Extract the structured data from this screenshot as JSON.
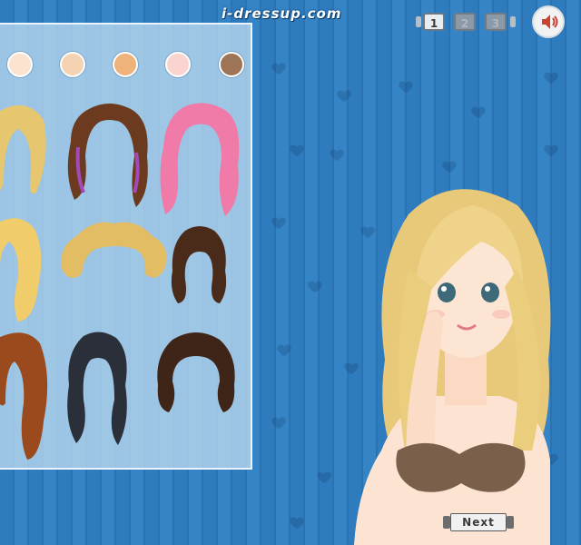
{
  "header": {
    "site_logo": "i-dressup.com"
  },
  "skin_tones": [
    {
      "name": "pale",
      "color": "#fbe3cf"
    },
    {
      "name": "light",
      "color": "#f4d2b2"
    },
    {
      "name": "tan",
      "color": "#efb27a"
    },
    {
      "name": "pink",
      "color": "#fcd4cf"
    },
    {
      "name": "brown",
      "color": "#9d7456"
    }
  ],
  "hair_styles": [
    {
      "name": "blonde-long-wavy",
      "color": "#e6c66e"
    },
    {
      "name": "brown-pigtails-purple-streak",
      "color": "#6b3a1f"
    },
    {
      "name": "pink-pigtails",
      "color": "#f07aa8"
    },
    {
      "name": "blonde-side-ponytail",
      "color": "#f0cc6a"
    },
    {
      "name": "blonde-short-curly",
      "color": "#e2bd63"
    },
    {
      "name": "brown-bob-bows",
      "color": "#4a2a18"
    },
    {
      "name": "auburn-long",
      "color": "#9b4a1e"
    },
    {
      "name": "black-pigtails",
      "color": "#2a2f3a"
    },
    {
      "name": "dark-brown-wavy",
      "color": "#3e2518"
    }
  ],
  "pager": {
    "pages": [
      "1",
      "2",
      "3"
    ],
    "current": "1"
  },
  "controls": {
    "next_label": "Next"
  }
}
